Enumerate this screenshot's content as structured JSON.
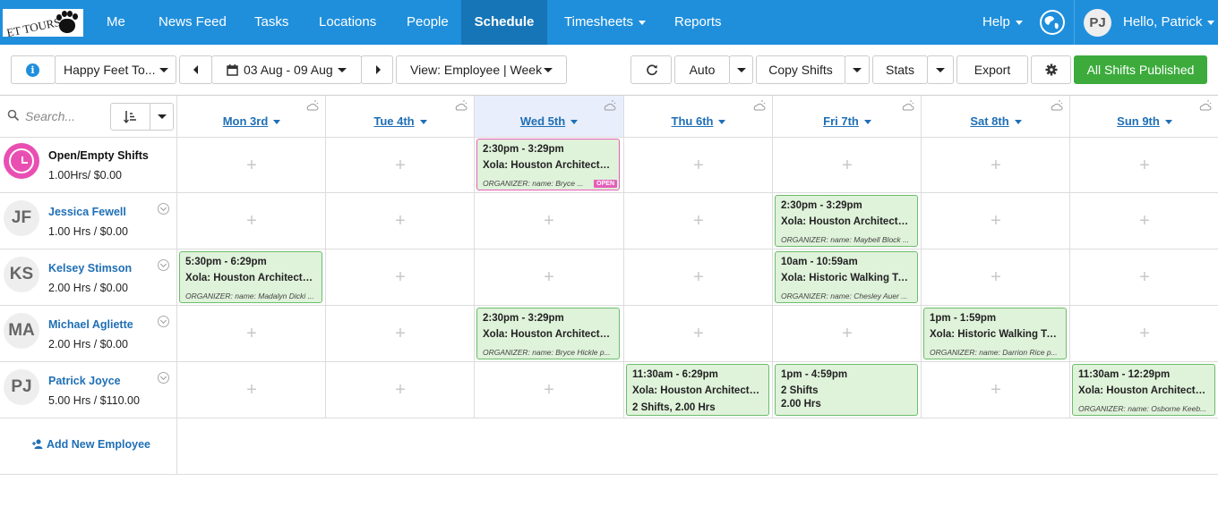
{
  "nav": {
    "logo_text": "ET TOURS",
    "items": [
      "Me",
      "News Feed",
      "Tasks",
      "Locations",
      "People",
      "Schedule",
      "Timesheets",
      "Reports"
    ],
    "help": "Help",
    "user_initials": "PJ",
    "greeting": "Hello, Patrick"
  },
  "toolbar": {
    "location": "Happy Feet To...",
    "date_range": "03 Aug - 09 Aug",
    "view": "View:  Employee | Week",
    "auto": "Auto",
    "copy_shifts": "Copy Shifts",
    "stats": "Stats",
    "export": "Export",
    "published": "All Shifts Published"
  },
  "search": {
    "placeholder": "Search..."
  },
  "days": [
    "Mon 3rd",
    "Tue 4th",
    "Wed 5th",
    "Thu 6th",
    "Fri 7th",
    "Sat 8th",
    "Sun 9th"
  ],
  "open_shifts": {
    "label": "Open/Empty Shifts",
    "hours": "1.00Hrs/ $0.00"
  },
  "employees": [
    {
      "initials": "JF",
      "name": "Jessica Fewell",
      "hours": "1.00 Hrs / $0.00"
    },
    {
      "initials": "KS",
      "name": "Kelsey Stimson",
      "hours": "2.00 Hrs / $0.00"
    },
    {
      "initials": "MA",
      "name": "Michael Agliette",
      "hours": "2.00 Hrs / $0.00"
    },
    {
      "initials": "PJ",
      "name": "Patrick Joyce",
      "hours": "5.00 Hrs / $110.00"
    }
  ],
  "shifts": [
    {
      "time": "2:30pm - 3:29pm",
      "title": "Xola: Houston Architectural...",
      "org": "ORGANIZER: name: Bryce ...",
      "tag": "OPEN"
    },
    {
      "time": "2:30pm - 3:29pm",
      "title": "Xola: Houston Architectural...",
      "org": "ORGANIZER: name: Maybell Block ..."
    },
    {
      "time": "5:30pm - 6:29pm",
      "title": "Xola: Houston Architectural...",
      "org": "ORGANIZER: name: Madalyn Dicki ..."
    },
    {
      "time": "10am - 10:59am",
      "title": "Xola: Historic Walking Tour",
      "org": "ORGANIZER: name: Chesley Auer ..."
    },
    {
      "time": "2:30pm - 3:29pm",
      "title": "Xola: Houston Architectural...",
      "org": "ORGANIZER: name: Bryce Hickle p..."
    },
    {
      "time": "1pm - 1:59pm",
      "title": "Xola: Historic Walking Tour",
      "org": "ORGANIZER: name: Darrion Rice p..."
    },
    {
      "time": "11:30am - 6:29pm",
      "title": "Xola: Houston Architectural...",
      "line3": "2 Shifts, 2.00 Hrs"
    },
    {
      "time": "1pm - 4:59pm",
      "title": "2 Shifts",
      "line3": "2.00 Hrs"
    },
    {
      "time": "11:30am - 12:29pm",
      "title": "Xola: Houston Architectural...",
      "org": "ORGANIZER: name: Osborne Keeb..."
    }
  ],
  "add_employee": "Add New Employee",
  "colors": {
    "nav": "#1f8fdc",
    "active_nav": "#1675b7",
    "published": "#3cab3c",
    "shift_bg": "#dff2da",
    "open_border": "#e55fb9"
  }
}
